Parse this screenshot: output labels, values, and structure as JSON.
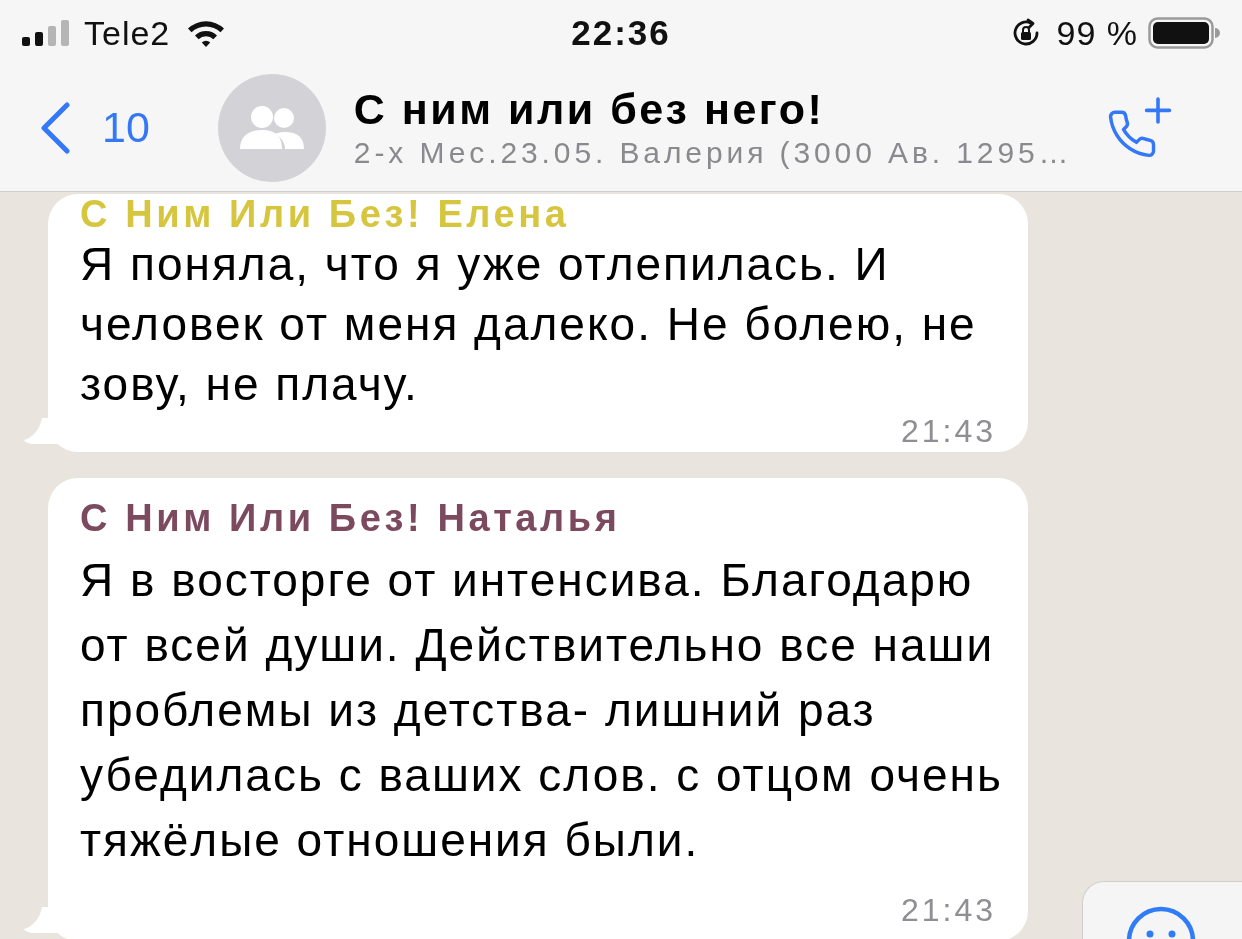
{
  "status_bar": {
    "carrier": "Tele2",
    "time": "22:36",
    "battery": "99 %"
  },
  "header": {
    "back_count": "10",
    "title": "С ним или без него!",
    "subtitle": "2-х Мес.23.05. Валерия (3000 Ав. 1295…"
  },
  "messages": [
    {
      "sender": "С Ним Или Без! Елена",
      "color": "#d6c63f",
      "text": "Я поняла, что я уже отлепилась. И человек от меня далеко. Не болею, не зову, не плачу.",
      "time": "21:43"
    },
    {
      "sender": "С Ним Или Без! Наталья",
      "color": "#7c4a5e",
      "text": "Я в восторге от интенсива. Благодарю от всей души. Действительно все наши проблемы из детства- лишний раз убедилась с ваших слов. с отцом очень тяжёлые отношения были.",
      "time": "21:43"
    }
  ]
}
